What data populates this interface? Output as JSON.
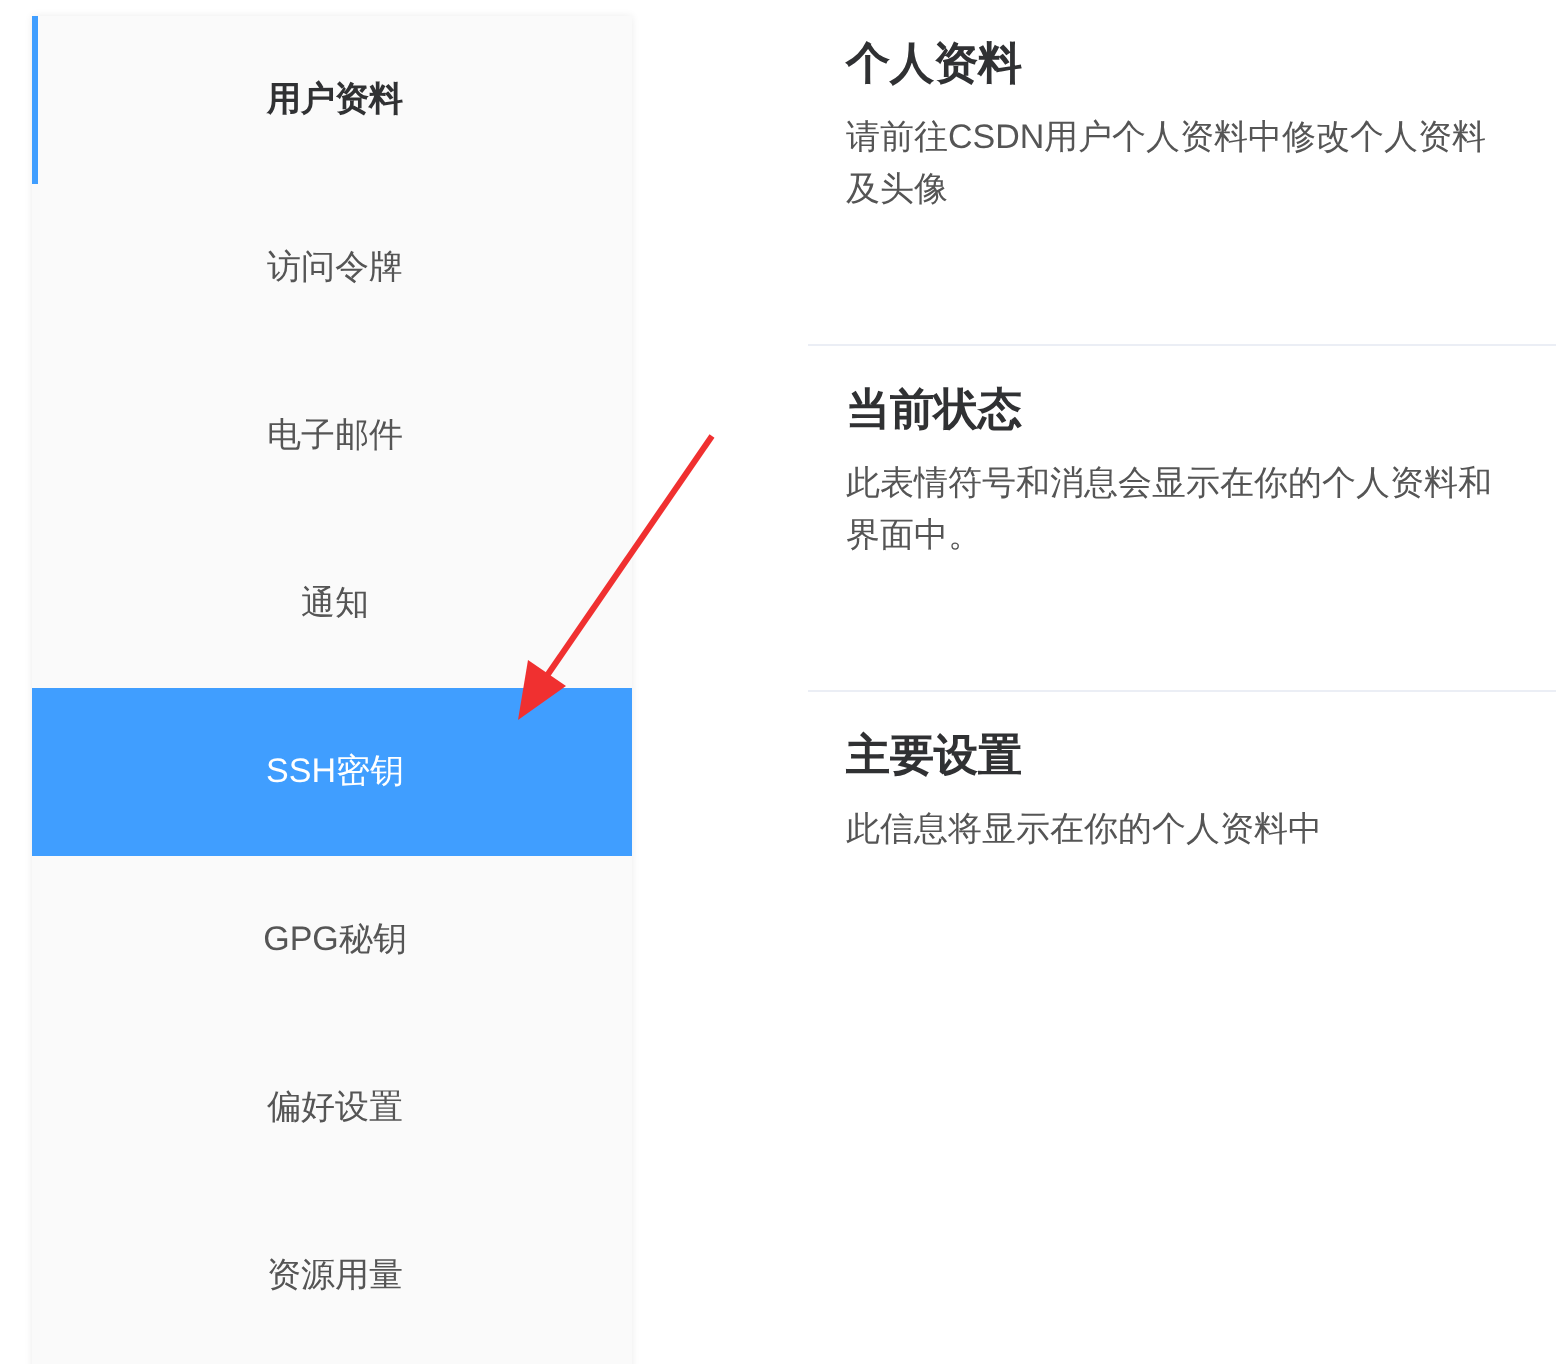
{
  "sidebar": {
    "items": [
      {
        "label": "用户资料",
        "selected": true,
        "hovered": false
      },
      {
        "label": "访问令牌",
        "selected": false,
        "hovered": false
      },
      {
        "label": "电子邮件",
        "selected": false,
        "hovered": false
      },
      {
        "label": "通知",
        "selected": false,
        "hovered": false
      },
      {
        "label": "SSH密钥",
        "selected": false,
        "hovered": true
      },
      {
        "label": "GPG秘钥",
        "selected": false,
        "hovered": false
      },
      {
        "label": "偏好设置",
        "selected": false,
        "hovered": false
      },
      {
        "label": "资源用量",
        "selected": false,
        "hovered": false
      }
    ]
  },
  "sections": [
    {
      "title": "个人资料",
      "description": "请前往CSDN用户个人资料中修改个人资料及头像"
    },
    {
      "title": "当前状态",
      "description": "此表情符号和消息会显示在你的个人资料和界面中。"
    },
    {
      "title": "主要设置",
      "description": "此信息将显示在你的个人资料中"
    }
  ]
}
